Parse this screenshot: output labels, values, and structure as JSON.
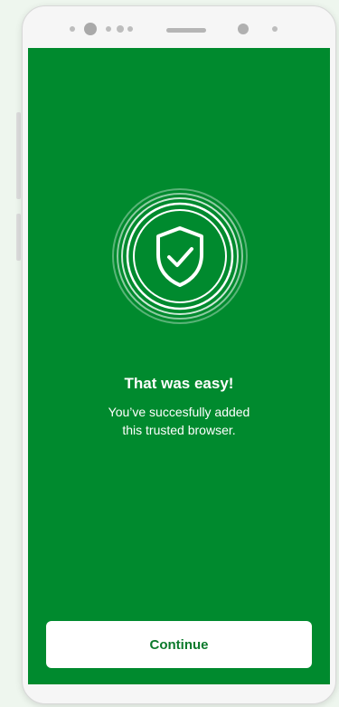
{
  "screen": {
    "title": "That was easy!",
    "message_line1": "You’ve succesfully added",
    "message_line2": "this trusted browser.",
    "icon": "shield-check-icon"
  },
  "actions": {
    "continue_label": "Continue"
  },
  "colors": {
    "background": "#008a2e",
    "button_bg": "#ffffff",
    "button_text": "#0c7a2c",
    "text": "#ffffff"
  }
}
